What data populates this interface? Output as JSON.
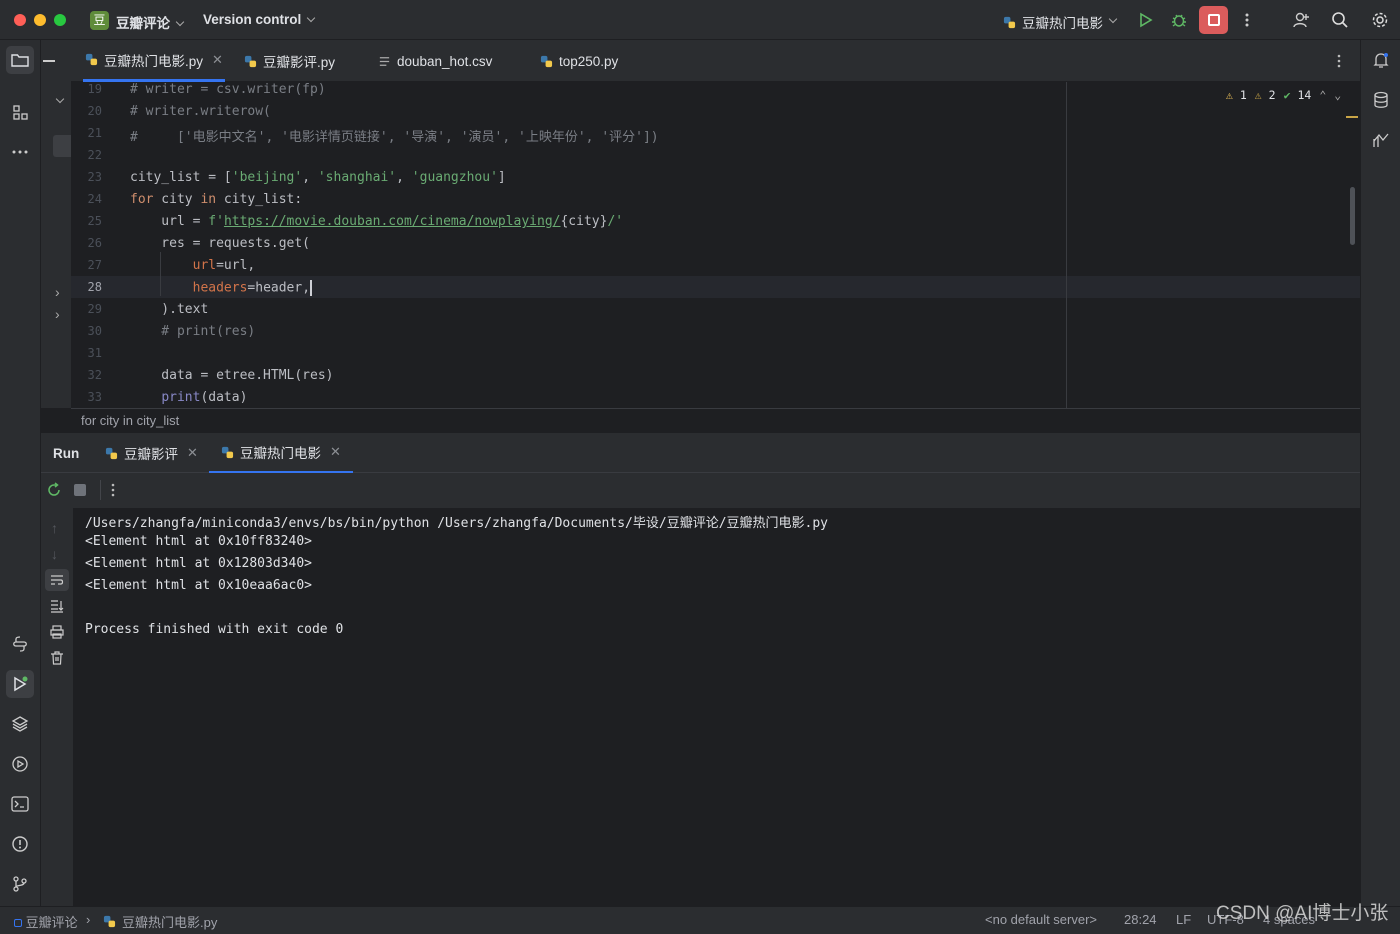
{
  "titlebar": {
    "project_badge": "豆",
    "project_name": "豆瓣评论",
    "vcs_label": "Version control",
    "run_config": "豆瓣热门电影"
  },
  "tabs": [
    {
      "label": "豆瓣热门电影.py",
      "active": true
    },
    {
      "label": "豆瓣影评.py",
      "active": false
    },
    {
      "label": "douban_hot.csv",
      "active": false
    },
    {
      "label": "top250.py",
      "active": false
    }
  ],
  "inspections": {
    "errors": "1",
    "warnings": "2",
    "ok": "14"
  },
  "editor": {
    "line_numbers": [
      "19",
      "20",
      "21",
      "22",
      "23",
      "24",
      "25",
      "26",
      "27",
      "28",
      "29",
      "30",
      "31",
      "32",
      "33"
    ],
    "current_line": "28"
  },
  "breadcrumb": "for city in city_list",
  "run": {
    "label": "Run",
    "tabs": [
      {
        "label": "豆瓣影评"
      },
      {
        "label": "豆瓣热门电影"
      }
    ],
    "console": [
      "/Users/zhangfa/miniconda3/envs/bs/bin/python /Users/zhangfa/Documents/毕设/豆瓣评论/豆瓣热门电影.py",
      "<Element html at 0x10ff83240>",
      "<Element html at 0x12803d340>",
      "<Element html at 0x10eaa6ac0>",
      "",
      "Process finished with exit code 0"
    ]
  },
  "statusbar": {
    "project": "豆瓣评论",
    "file": "豆瓣热门电影.py",
    "server": "<no default server>",
    "position": "28:24",
    "line_sep": "LF",
    "encoding": "UTF-8",
    "indent": "4 spaces"
  },
  "watermark": "CSDN @AI博士小张",
  "colors": {
    "accent": "#3574f0",
    "keyword": "#cf8e6d",
    "string": "#6aab73",
    "comment": "#7a7e85"
  }
}
